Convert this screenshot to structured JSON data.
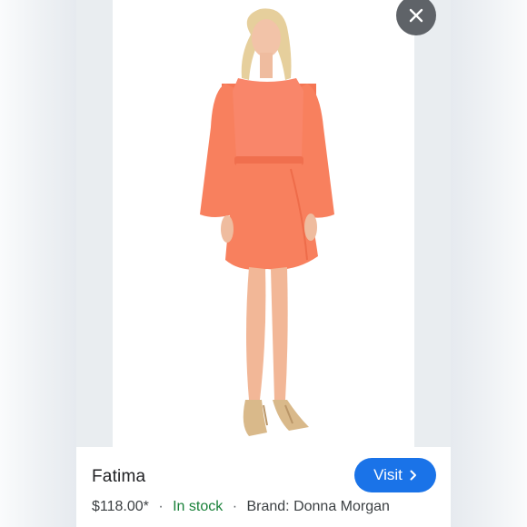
{
  "product": {
    "title": "Fatima",
    "price": "$118.00*",
    "availability": "In stock",
    "brand": "Brand: Donna Morgan",
    "separator": "·"
  },
  "actions": {
    "visit_label": "Visit",
    "visit_icon": "chevron-right-icon",
    "close_icon": "close-icon"
  },
  "colors": {
    "accent": "#1a73e8",
    "in_stock": "#188038",
    "close_button": "#5f6368",
    "dress": "#f8805e"
  }
}
